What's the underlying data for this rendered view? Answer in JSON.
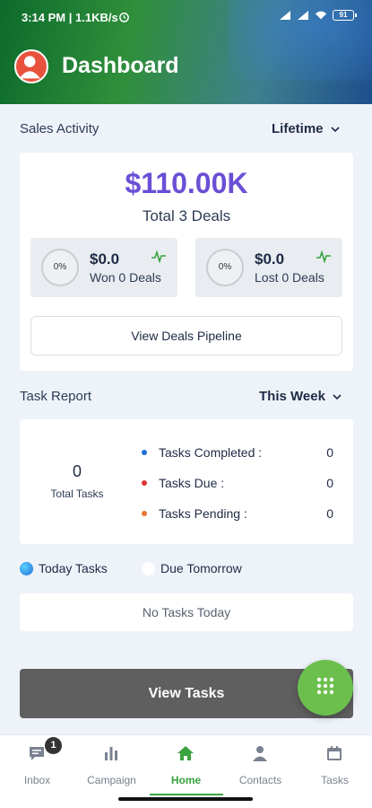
{
  "status_bar": {
    "time_and_speed": "3:14 PM | 1.1KB/s",
    "battery": "91"
  },
  "header": {
    "title": "Dashboard"
  },
  "sales_activity": {
    "label": "Sales Activity",
    "period": "Lifetime",
    "amount": "$110.00K",
    "total_deals": "Total 3 Deals",
    "won": {
      "percent": "0%",
      "amount": "$0.0",
      "label": "Won 0 Deals"
    },
    "lost": {
      "percent": "0%",
      "amount": "$0.0",
      "label": "Lost 0 Deals"
    },
    "pipeline_button": "View Deals Pipeline"
  },
  "task_report": {
    "label": "Task Report",
    "period": "This Week",
    "total_value": "0",
    "total_label": "Total Tasks",
    "rows": [
      {
        "label": "Tasks Completed :",
        "value": "0",
        "color": "#1f6fd6"
      },
      {
        "label": "Tasks Due :",
        "value": "0",
        "color": "#e03131"
      },
      {
        "label": "Tasks Pending :",
        "value": "0",
        "color": "#e8762c"
      }
    ]
  },
  "task_tabs": {
    "today": "Today Tasks",
    "tomorrow": "Due Tomorrow"
  },
  "empty_state": "No Tasks Today",
  "view_tasks_button": "View Tasks",
  "colors": {
    "accent": "#3aa23f",
    "amount": "#6a4fd6",
    "fab": "#6cbf4d"
  },
  "nav": {
    "inbox": {
      "label": "Inbox",
      "badge": "1",
      "icon": "chat-icon"
    },
    "campaign": {
      "label": "Campaign",
      "icon": "bar-chart-icon"
    },
    "home": {
      "label": "Home",
      "icon": "home-icon",
      "active": true
    },
    "contacts": {
      "label": "Contacts",
      "icon": "person-icon"
    },
    "tasks": {
      "label": "Tasks",
      "icon": "calendar-icon"
    }
  }
}
